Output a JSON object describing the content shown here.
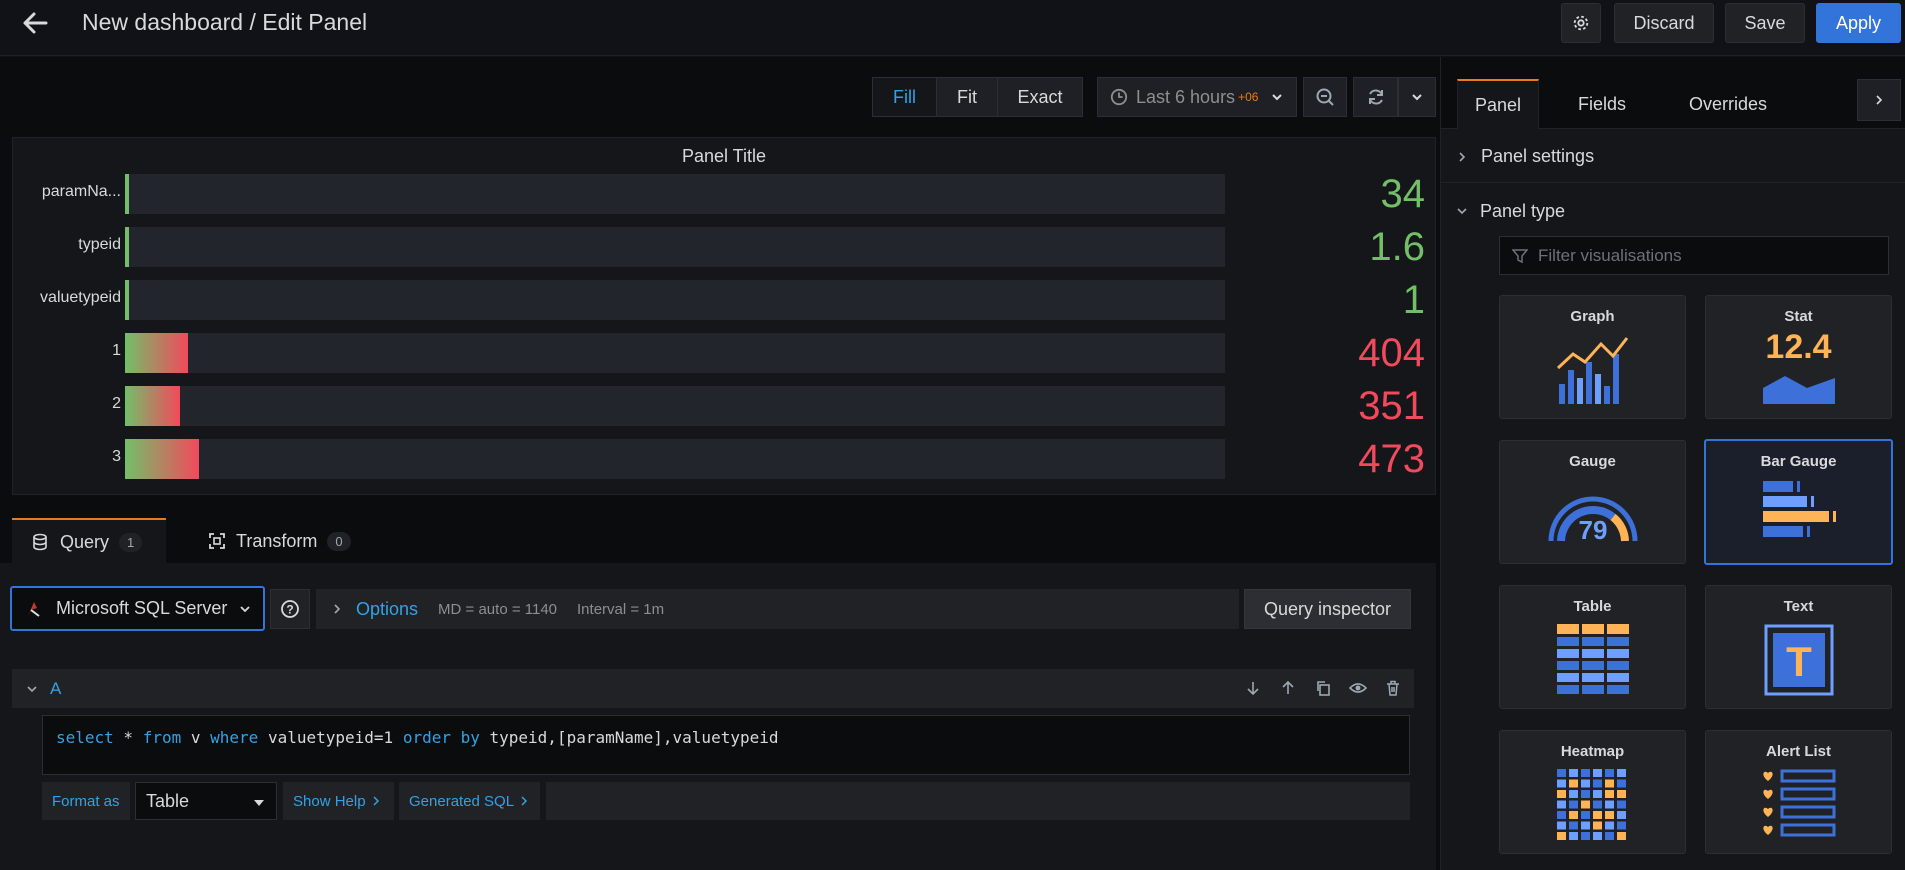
{
  "header": {
    "title": "New dashboard / Edit Panel",
    "discard_label": "Discard",
    "save_label": "Save",
    "apply_label": "Apply"
  },
  "toolbar": {
    "view_modes": [
      "Fill",
      "Fit",
      "Exact"
    ],
    "active_view_mode": "Fill",
    "time_range": "Last 6 hours",
    "timezone": "+06"
  },
  "panel": {
    "title": "Panel Title",
    "rows": [
      {
        "label": "paramNa...",
        "value": "34",
        "fill_fraction": 0.004,
        "color": "#73bf69",
        "gradient": false
      },
      {
        "label": "typeid",
        "value": "1.6",
        "fill_fraction": 0.002,
        "color": "#73bf69",
        "gradient": false
      },
      {
        "label": "valuetypeid",
        "value": "1",
        "fill_fraction": 0.001,
        "color": "#73bf69",
        "gradient": false
      },
      {
        "label": "1",
        "value": "404",
        "fill_fraction": 0.057,
        "color": "#f2495c",
        "gradient": true
      },
      {
        "label": "2",
        "value": "351",
        "fill_fraction": 0.05,
        "color": "#f2495c",
        "gradient": true
      },
      {
        "label": "3",
        "value": "473",
        "fill_fraction": 0.067,
        "color": "#f2495c",
        "gradient": true
      }
    ]
  },
  "query_tabs": [
    {
      "label": "Query",
      "count": "1"
    },
    {
      "label": "Transform",
      "count": "0"
    }
  ],
  "query": {
    "datasource": "Microsoft SQL Server",
    "options_label": "Options",
    "md_text": "MD = auto = 1140",
    "interval_text": "Interval = 1m",
    "inspector_label": "Query inspector",
    "ref_id": "A",
    "sql_tokens": [
      {
        "t": "select",
        "k": true
      },
      {
        "t": " * ",
        "k": false
      },
      {
        "t": "from",
        "k": true
      },
      {
        "t": " v ",
        "k": false
      },
      {
        "t": "where",
        "k": true
      },
      {
        "t": " valuetypeid=1 ",
        "k": false
      },
      {
        "t": "order by",
        "k": true
      },
      {
        "t": " typeid,[paramName],valuetypeid",
        "k": false
      }
    ],
    "format_as_label": "Format as",
    "format_value": "Table",
    "show_help_label": "Show Help",
    "generated_sql_label": "Generated SQL"
  },
  "options_pane": {
    "tabs": [
      "Panel",
      "Fields",
      "Overrides"
    ],
    "active_tab": "Panel",
    "panel_settings_label": "Panel settings",
    "panel_type_label": "Panel type",
    "filter_placeholder": "Filter visualisations",
    "visualisations": [
      "Graph",
      "Stat",
      "Gauge",
      "Bar Gauge",
      "Table",
      "Text",
      "Heatmap",
      "Alert List"
    ],
    "selected_visualisation": "Bar Gauge",
    "stat_preview_value": "12.4",
    "gauge_preview_value": "79",
    "text_preview_letter": "T"
  }
}
